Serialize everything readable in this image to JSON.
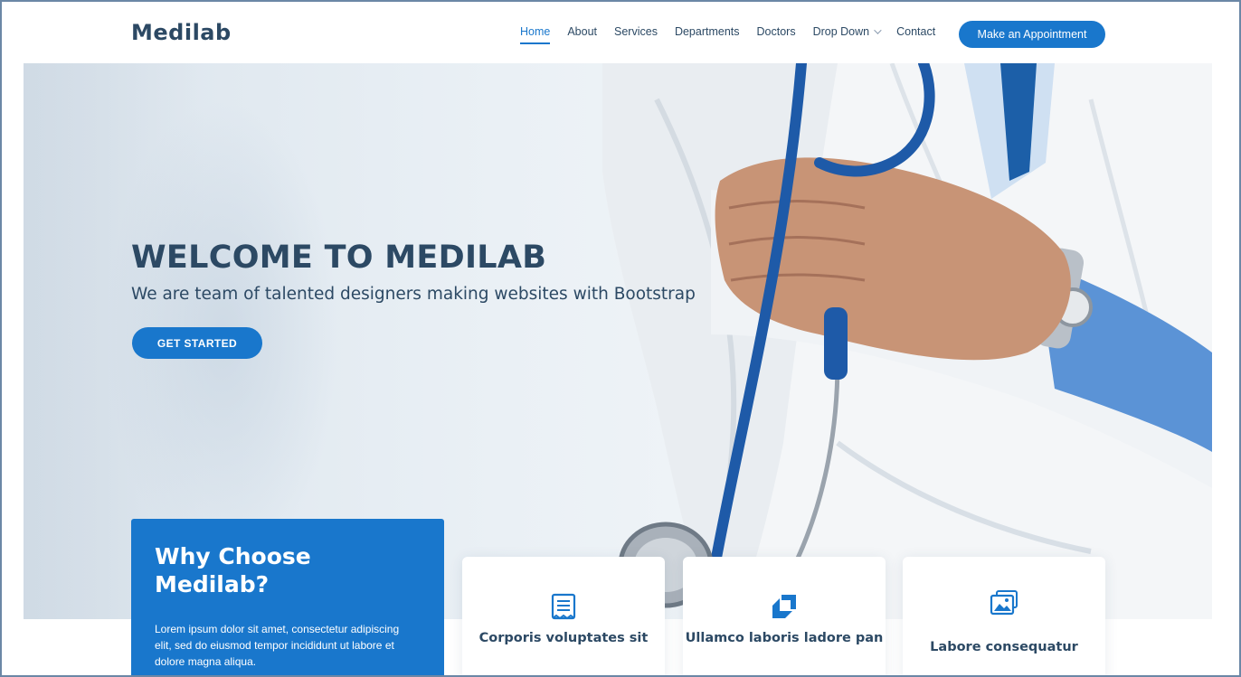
{
  "header": {
    "logo": "Medilab",
    "nav": [
      {
        "label": "Home",
        "active": true
      },
      {
        "label": "About"
      },
      {
        "label": "Services"
      },
      {
        "label": "Departments"
      },
      {
        "label": "Doctors"
      },
      {
        "label": "Drop Down",
        "dropdown": true
      },
      {
        "label": "Contact"
      }
    ],
    "appointment_label": "Make an Appointment"
  },
  "hero": {
    "title": "WELCOME TO MEDILAB",
    "subtitle": "We are team of talented designers making websites with Bootstrap",
    "cta_label": "GET STARTED"
  },
  "why": {
    "title": "Why Choose Medilab?",
    "text": "Lorem ipsum dolor sit amet, consectetur adipiscing elit, sed do eiusmod tempor incididunt ut labore et dolore magna aliqua."
  },
  "cards": [
    {
      "title": "Corporis voluptates sit",
      "icon": "receipt-icon"
    },
    {
      "title": "Ullamco laboris ladore pan",
      "icon": "cube-alt-icon"
    },
    {
      "title": "Labore consequatur",
      "icon": "images-icon"
    }
  ],
  "colors": {
    "accent": "#1977cc",
    "text": "#2c4964"
  }
}
